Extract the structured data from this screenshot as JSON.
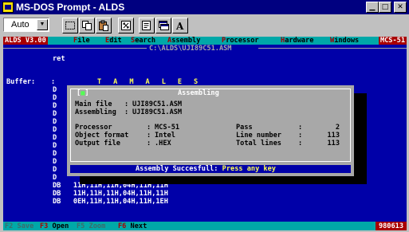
{
  "window": {
    "title": "MS-DOS Prompt - ALDS",
    "buttons": [
      "minimize",
      "maximize",
      "close"
    ]
  },
  "toolbar": {
    "font_size_value": "Auto",
    "tools": [
      "mark-icon",
      "copy-icon",
      "paste-icon",
      "fullscreen-icon",
      "properties-icon",
      "background-icon",
      "font-icon"
    ]
  },
  "console": {
    "version": "ALDS V3.00",
    "menu": [
      {
        "hotkey": "F",
        "rest": "ile"
      },
      {
        "hotkey": "E",
        "rest": "dit"
      },
      {
        "hotkey": "S",
        "rest": "earch"
      },
      {
        "hotkey": "A",
        "rest": "ssembly"
      },
      {
        "hotkey": "P",
        "rest": "rocessor"
      },
      {
        "hotkey": "H",
        "rest": "ardware"
      },
      {
        "hotkey": "W",
        "rest": "indows"
      }
    ],
    "processor_badge": "MCS-51",
    "path": "C:\\ALDS\\UJI89C51.ASM",
    "ret_line": "ret",
    "buffer_label": "Buffer:",
    "buffer_colon": ":",
    "buffer_text": "TAMALES",
    "db_lines": [
      {
        "kw": "DB",
        "val": "11H,11H,11H,04H,11H,11H"
      },
      {
        "kw": "DB",
        "val": "11H,11H,11H,04H,11H,11H"
      },
      {
        "kw": "DB",
        "val": "0EH,11H,11H,04H,11H,1EH"
      }
    ]
  },
  "dialog": {
    "title": "Assembling",
    "close_glyph": "■",
    "main_file_label": "Main file",
    "main_file_value": "UJI89C51.ASM",
    "assembling_label": "Assembling",
    "assembling_value": "UJI89C51.ASM",
    "processor_label": "Processor",
    "processor_value": "MCS-51",
    "format_label": "Object format",
    "format_value": "Intel",
    "output_label": "Output file",
    "output_value": ".HEX",
    "pass_label": "Pass",
    "pass_value": "2",
    "line_label": "Line number",
    "line_value": "113",
    "total_label": "Total lines",
    "total_value": "113",
    "status_message": "Assembly Succesfull:",
    "status_prompt": "Press any key"
  },
  "function_bar": {
    "keys": [
      {
        "key": "F2",
        "label": "Save",
        "enabled": false
      },
      {
        "key": "F3",
        "label": "Open",
        "enabled": true
      },
      {
        "key": "F5",
        "label": "Zoom",
        "enabled": false
      },
      {
        "key": "F6",
        "label": "Next",
        "enabled": true
      }
    ],
    "date": "980613"
  }
}
